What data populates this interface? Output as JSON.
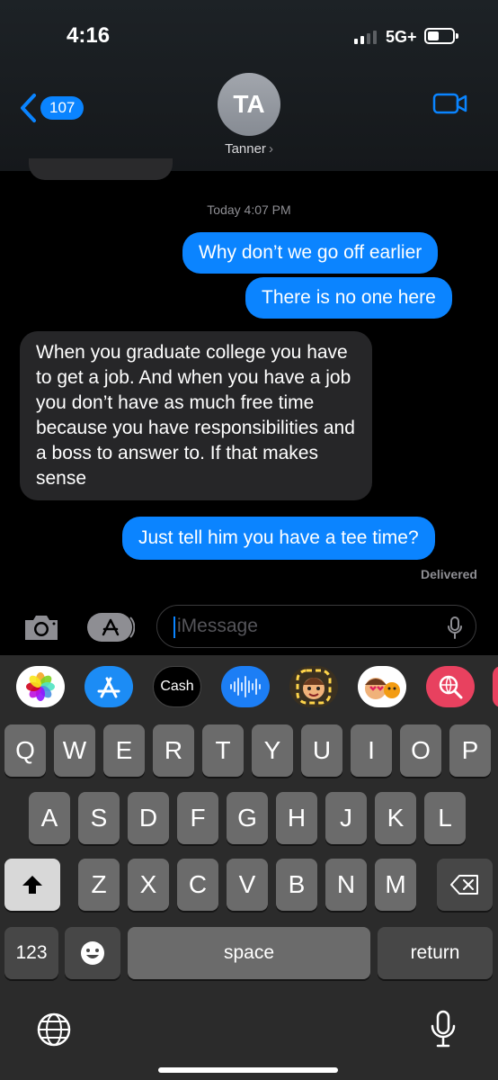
{
  "status": {
    "time": "4:16",
    "network": "5G+"
  },
  "header": {
    "back_count": "107",
    "avatar_initials": "TA",
    "contact_name": "Tanner"
  },
  "conversation": {
    "timestamp": "Today 4:07 PM",
    "messages": [
      {
        "direction": "outgoing",
        "text": "Why don’t we go off earlier"
      },
      {
        "direction": "outgoing",
        "text": "There is no one here"
      },
      {
        "direction": "incoming",
        "text": "When you graduate college you have to get a job. And when you have a job you don’t have as much free time because you have responsibilities and a boss to answer to. If that makes sense"
      },
      {
        "direction": "outgoing",
        "text": "Just tell him you have a tee time?"
      }
    ],
    "status": "Delivered"
  },
  "composer": {
    "placeholder": "iMessage"
  },
  "app_strip": [
    {
      "name": "photos-app-icon"
    },
    {
      "name": "app-store-icon"
    },
    {
      "name": "apple-cash-icon",
      "label": "Cash"
    },
    {
      "name": "audio-message-icon"
    },
    {
      "name": "memoji-icon"
    },
    {
      "name": "memoji-stickers-icon"
    },
    {
      "name": "web-search-icon"
    }
  ],
  "keyboard": {
    "row1": [
      "Q",
      "W",
      "E",
      "R",
      "T",
      "Y",
      "U",
      "I",
      "O",
      "P"
    ],
    "row2": [
      "A",
      "S",
      "D",
      "F",
      "G",
      "H",
      "J",
      "K",
      "L"
    ],
    "row3": [
      "Z",
      "X",
      "C",
      "V",
      "B",
      "N",
      "M"
    ],
    "numbers_key": "123",
    "space_key": "space",
    "return_key": "return"
  },
  "colors": {
    "outgoing_bubble": "#0b84ff",
    "incoming_bubble": "#262628",
    "accent": "#0a84ff"
  }
}
